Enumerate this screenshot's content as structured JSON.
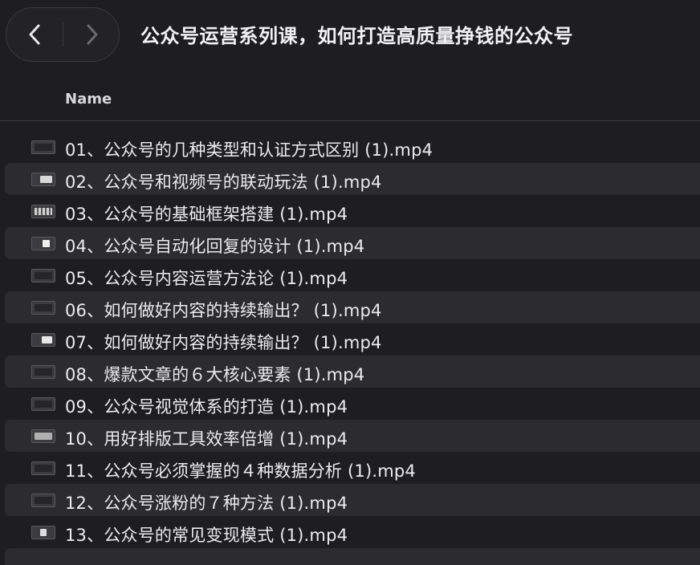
{
  "window": {
    "title": "公众号运营系列课，如何打造高质量挣钱的公众号"
  },
  "toolbar": {
    "back_icon": "chevron-left-icon",
    "forward_icon": "chevron-right-icon"
  },
  "columns": {
    "name_header": "Name"
  },
  "files": [
    {
      "name": "01、公众号的几种类型和认证方式区别 (1).mp4",
      "thumb": "dark"
    },
    {
      "name": "02、公众号和视频号的联动玩法 (1).mp4",
      "thumb": "light"
    },
    {
      "name": "03、公众号的基础框架搭建 (1).mp4",
      "thumb": "striped"
    },
    {
      "name": "04、公众号自动化回复的设计 (1).mp4",
      "thumb": "white"
    },
    {
      "name": "05、公众号内容运营方法论 (1).mp4",
      "thumb": "dark"
    },
    {
      "name": "06、如何做好内容的持续输出？ (1).mp4",
      "thumb": "dark"
    },
    {
      "name": "07、如何做好内容的持续输出？  (1).mp4",
      "thumb": "bright"
    },
    {
      "name": "08、爆款文章的６大核心要素 (1).mp4",
      "thumb": "dark"
    },
    {
      "name": "09、公众号视觉体系的打造 (1).mp4",
      "thumb": "dark"
    },
    {
      "name": "10、用好排版工具效率倍增 (1).mp4",
      "thumb": "gray"
    },
    {
      "name": "11、公众号必须掌握的４种数据分析 (1).mp4",
      "thumb": "dark"
    },
    {
      "name": "12、公众号涨粉的７种方法 (1).mp4",
      "thumb": "dark"
    },
    {
      "name": "13、公众号的常见变现模式 (1).mp4",
      "thumb": "mixed"
    }
  ],
  "colors": {
    "background": "#1e1e22",
    "row_alt": "#2b2b30",
    "text": "#ececee"
  }
}
